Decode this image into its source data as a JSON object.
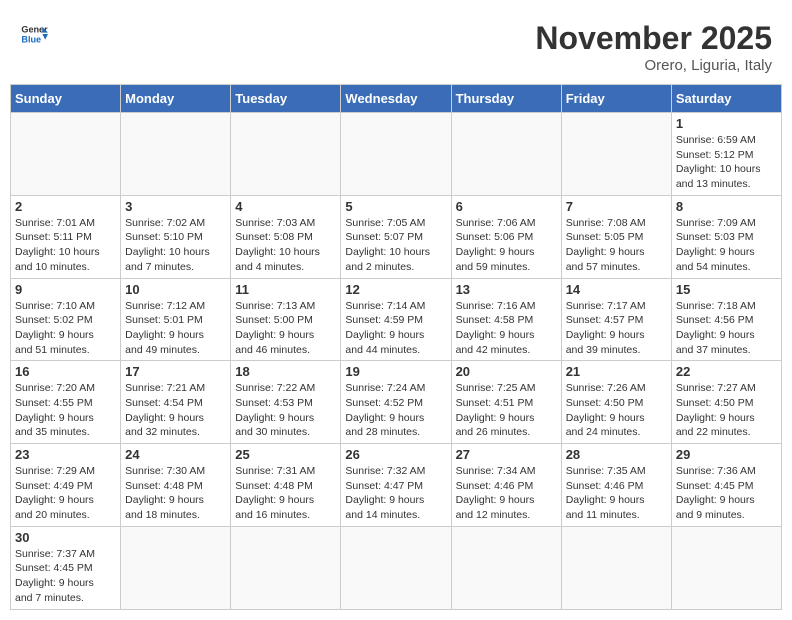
{
  "header": {
    "logo_general": "General",
    "logo_blue": "Blue",
    "month_title": "November 2025",
    "location": "Orero, Liguria, Italy"
  },
  "weekdays": [
    "Sunday",
    "Monday",
    "Tuesday",
    "Wednesday",
    "Thursday",
    "Friday",
    "Saturday"
  ],
  "weeks": [
    [
      {
        "day": "",
        "info": ""
      },
      {
        "day": "",
        "info": ""
      },
      {
        "day": "",
        "info": ""
      },
      {
        "day": "",
        "info": ""
      },
      {
        "day": "",
        "info": ""
      },
      {
        "day": "",
        "info": ""
      },
      {
        "day": "1",
        "info": "Sunrise: 6:59 AM\nSunset: 5:12 PM\nDaylight: 10 hours\nand 13 minutes."
      }
    ],
    [
      {
        "day": "2",
        "info": "Sunrise: 7:01 AM\nSunset: 5:11 PM\nDaylight: 10 hours\nand 10 minutes."
      },
      {
        "day": "3",
        "info": "Sunrise: 7:02 AM\nSunset: 5:10 PM\nDaylight: 10 hours\nand 7 minutes."
      },
      {
        "day": "4",
        "info": "Sunrise: 7:03 AM\nSunset: 5:08 PM\nDaylight: 10 hours\nand 4 minutes."
      },
      {
        "day": "5",
        "info": "Sunrise: 7:05 AM\nSunset: 5:07 PM\nDaylight: 10 hours\nand 2 minutes."
      },
      {
        "day": "6",
        "info": "Sunrise: 7:06 AM\nSunset: 5:06 PM\nDaylight: 9 hours\nand 59 minutes."
      },
      {
        "day": "7",
        "info": "Sunrise: 7:08 AM\nSunset: 5:05 PM\nDaylight: 9 hours\nand 57 minutes."
      },
      {
        "day": "8",
        "info": "Sunrise: 7:09 AM\nSunset: 5:03 PM\nDaylight: 9 hours\nand 54 minutes."
      }
    ],
    [
      {
        "day": "9",
        "info": "Sunrise: 7:10 AM\nSunset: 5:02 PM\nDaylight: 9 hours\nand 51 minutes."
      },
      {
        "day": "10",
        "info": "Sunrise: 7:12 AM\nSunset: 5:01 PM\nDaylight: 9 hours\nand 49 minutes."
      },
      {
        "day": "11",
        "info": "Sunrise: 7:13 AM\nSunset: 5:00 PM\nDaylight: 9 hours\nand 46 minutes."
      },
      {
        "day": "12",
        "info": "Sunrise: 7:14 AM\nSunset: 4:59 PM\nDaylight: 9 hours\nand 44 minutes."
      },
      {
        "day": "13",
        "info": "Sunrise: 7:16 AM\nSunset: 4:58 PM\nDaylight: 9 hours\nand 42 minutes."
      },
      {
        "day": "14",
        "info": "Sunrise: 7:17 AM\nSunset: 4:57 PM\nDaylight: 9 hours\nand 39 minutes."
      },
      {
        "day": "15",
        "info": "Sunrise: 7:18 AM\nSunset: 4:56 PM\nDaylight: 9 hours\nand 37 minutes."
      }
    ],
    [
      {
        "day": "16",
        "info": "Sunrise: 7:20 AM\nSunset: 4:55 PM\nDaylight: 9 hours\nand 35 minutes."
      },
      {
        "day": "17",
        "info": "Sunrise: 7:21 AM\nSunset: 4:54 PM\nDaylight: 9 hours\nand 32 minutes."
      },
      {
        "day": "18",
        "info": "Sunrise: 7:22 AM\nSunset: 4:53 PM\nDaylight: 9 hours\nand 30 minutes."
      },
      {
        "day": "19",
        "info": "Sunrise: 7:24 AM\nSunset: 4:52 PM\nDaylight: 9 hours\nand 28 minutes."
      },
      {
        "day": "20",
        "info": "Sunrise: 7:25 AM\nSunset: 4:51 PM\nDaylight: 9 hours\nand 26 minutes."
      },
      {
        "day": "21",
        "info": "Sunrise: 7:26 AM\nSunset: 4:50 PM\nDaylight: 9 hours\nand 24 minutes."
      },
      {
        "day": "22",
        "info": "Sunrise: 7:27 AM\nSunset: 4:50 PM\nDaylight: 9 hours\nand 22 minutes."
      }
    ],
    [
      {
        "day": "23",
        "info": "Sunrise: 7:29 AM\nSunset: 4:49 PM\nDaylight: 9 hours\nand 20 minutes."
      },
      {
        "day": "24",
        "info": "Sunrise: 7:30 AM\nSunset: 4:48 PM\nDaylight: 9 hours\nand 18 minutes."
      },
      {
        "day": "25",
        "info": "Sunrise: 7:31 AM\nSunset: 4:48 PM\nDaylight: 9 hours\nand 16 minutes."
      },
      {
        "day": "26",
        "info": "Sunrise: 7:32 AM\nSunset: 4:47 PM\nDaylight: 9 hours\nand 14 minutes."
      },
      {
        "day": "27",
        "info": "Sunrise: 7:34 AM\nSunset: 4:46 PM\nDaylight: 9 hours\nand 12 minutes."
      },
      {
        "day": "28",
        "info": "Sunrise: 7:35 AM\nSunset: 4:46 PM\nDaylight: 9 hours\nand 11 minutes."
      },
      {
        "day": "29",
        "info": "Sunrise: 7:36 AM\nSunset: 4:45 PM\nDaylight: 9 hours\nand 9 minutes."
      }
    ],
    [
      {
        "day": "30",
        "info": "Sunrise: 7:37 AM\nSunset: 4:45 PM\nDaylight: 9 hours\nand 7 minutes."
      },
      {
        "day": "",
        "info": ""
      },
      {
        "day": "",
        "info": ""
      },
      {
        "day": "",
        "info": ""
      },
      {
        "day": "",
        "info": ""
      },
      {
        "day": "",
        "info": ""
      },
      {
        "day": "",
        "info": ""
      }
    ]
  ]
}
